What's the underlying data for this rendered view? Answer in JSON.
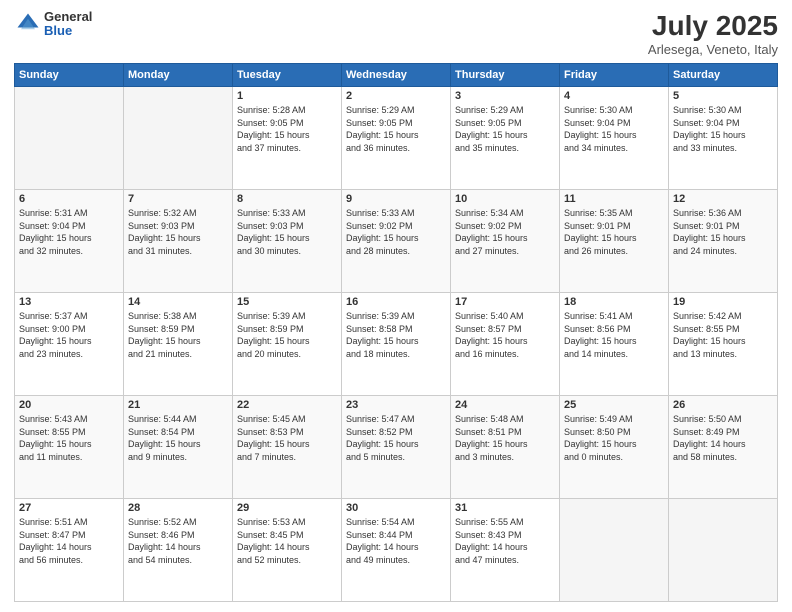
{
  "logo": {
    "general": "General",
    "blue": "Blue"
  },
  "header": {
    "title": "July 2025",
    "subtitle": "Arlesega, Veneto, Italy"
  },
  "weekdays": [
    "Sunday",
    "Monday",
    "Tuesday",
    "Wednesday",
    "Thursday",
    "Friday",
    "Saturday"
  ],
  "weeks": [
    [
      {
        "day": "",
        "info": ""
      },
      {
        "day": "",
        "info": ""
      },
      {
        "day": "1",
        "info": "Sunrise: 5:28 AM\nSunset: 9:05 PM\nDaylight: 15 hours\nand 37 minutes."
      },
      {
        "day": "2",
        "info": "Sunrise: 5:29 AM\nSunset: 9:05 PM\nDaylight: 15 hours\nand 36 minutes."
      },
      {
        "day": "3",
        "info": "Sunrise: 5:29 AM\nSunset: 9:05 PM\nDaylight: 15 hours\nand 35 minutes."
      },
      {
        "day": "4",
        "info": "Sunrise: 5:30 AM\nSunset: 9:04 PM\nDaylight: 15 hours\nand 34 minutes."
      },
      {
        "day": "5",
        "info": "Sunrise: 5:30 AM\nSunset: 9:04 PM\nDaylight: 15 hours\nand 33 minutes."
      }
    ],
    [
      {
        "day": "6",
        "info": "Sunrise: 5:31 AM\nSunset: 9:04 PM\nDaylight: 15 hours\nand 32 minutes."
      },
      {
        "day": "7",
        "info": "Sunrise: 5:32 AM\nSunset: 9:03 PM\nDaylight: 15 hours\nand 31 minutes."
      },
      {
        "day": "8",
        "info": "Sunrise: 5:33 AM\nSunset: 9:03 PM\nDaylight: 15 hours\nand 30 minutes."
      },
      {
        "day": "9",
        "info": "Sunrise: 5:33 AM\nSunset: 9:02 PM\nDaylight: 15 hours\nand 28 minutes."
      },
      {
        "day": "10",
        "info": "Sunrise: 5:34 AM\nSunset: 9:02 PM\nDaylight: 15 hours\nand 27 minutes."
      },
      {
        "day": "11",
        "info": "Sunrise: 5:35 AM\nSunset: 9:01 PM\nDaylight: 15 hours\nand 26 minutes."
      },
      {
        "day": "12",
        "info": "Sunrise: 5:36 AM\nSunset: 9:01 PM\nDaylight: 15 hours\nand 24 minutes."
      }
    ],
    [
      {
        "day": "13",
        "info": "Sunrise: 5:37 AM\nSunset: 9:00 PM\nDaylight: 15 hours\nand 23 minutes."
      },
      {
        "day": "14",
        "info": "Sunrise: 5:38 AM\nSunset: 8:59 PM\nDaylight: 15 hours\nand 21 minutes."
      },
      {
        "day": "15",
        "info": "Sunrise: 5:39 AM\nSunset: 8:59 PM\nDaylight: 15 hours\nand 20 minutes."
      },
      {
        "day": "16",
        "info": "Sunrise: 5:39 AM\nSunset: 8:58 PM\nDaylight: 15 hours\nand 18 minutes."
      },
      {
        "day": "17",
        "info": "Sunrise: 5:40 AM\nSunset: 8:57 PM\nDaylight: 15 hours\nand 16 minutes."
      },
      {
        "day": "18",
        "info": "Sunrise: 5:41 AM\nSunset: 8:56 PM\nDaylight: 15 hours\nand 14 minutes."
      },
      {
        "day": "19",
        "info": "Sunrise: 5:42 AM\nSunset: 8:55 PM\nDaylight: 15 hours\nand 13 minutes."
      }
    ],
    [
      {
        "day": "20",
        "info": "Sunrise: 5:43 AM\nSunset: 8:55 PM\nDaylight: 15 hours\nand 11 minutes."
      },
      {
        "day": "21",
        "info": "Sunrise: 5:44 AM\nSunset: 8:54 PM\nDaylight: 15 hours\nand 9 minutes."
      },
      {
        "day": "22",
        "info": "Sunrise: 5:45 AM\nSunset: 8:53 PM\nDaylight: 15 hours\nand 7 minutes."
      },
      {
        "day": "23",
        "info": "Sunrise: 5:47 AM\nSunset: 8:52 PM\nDaylight: 15 hours\nand 5 minutes."
      },
      {
        "day": "24",
        "info": "Sunrise: 5:48 AM\nSunset: 8:51 PM\nDaylight: 15 hours\nand 3 minutes."
      },
      {
        "day": "25",
        "info": "Sunrise: 5:49 AM\nSunset: 8:50 PM\nDaylight: 15 hours\nand 0 minutes."
      },
      {
        "day": "26",
        "info": "Sunrise: 5:50 AM\nSunset: 8:49 PM\nDaylight: 14 hours\nand 58 minutes."
      }
    ],
    [
      {
        "day": "27",
        "info": "Sunrise: 5:51 AM\nSunset: 8:47 PM\nDaylight: 14 hours\nand 56 minutes."
      },
      {
        "day": "28",
        "info": "Sunrise: 5:52 AM\nSunset: 8:46 PM\nDaylight: 14 hours\nand 54 minutes."
      },
      {
        "day": "29",
        "info": "Sunrise: 5:53 AM\nSunset: 8:45 PM\nDaylight: 14 hours\nand 52 minutes."
      },
      {
        "day": "30",
        "info": "Sunrise: 5:54 AM\nSunset: 8:44 PM\nDaylight: 14 hours\nand 49 minutes."
      },
      {
        "day": "31",
        "info": "Sunrise: 5:55 AM\nSunset: 8:43 PM\nDaylight: 14 hours\nand 47 minutes."
      },
      {
        "day": "",
        "info": ""
      },
      {
        "day": "",
        "info": ""
      }
    ]
  ]
}
